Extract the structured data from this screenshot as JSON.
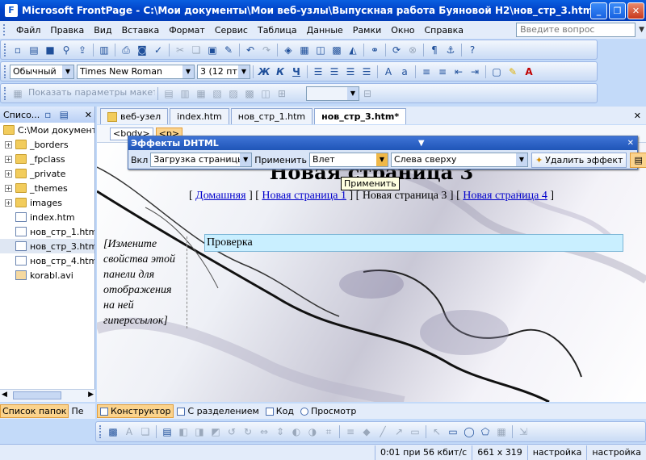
{
  "window": {
    "title": "Microsoft FrontPage - C:\\Мои документы\\Мои веб-узлы\\Выпускная работа Буяновой Н2\\нов_стр_3.htm"
  },
  "menu": {
    "items": [
      "Файл",
      "Правка",
      "Вид",
      "Вставка",
      "Формат",
      "Сервис",
      "Таблица",
      "Данные",
      "Рамки",
      "Окно",
      "Справка"
    ],
    "ask_placeholder": "Введите вопрос"
  },
  "formatting": {
    "style": "Обычный",
    "font": "Times New Roman",
    "size": "3  (12 пт)",
    "bold": "Ж",
    "italic": "К"
  },
  "toolbar3": {
    "layout_label": "Показать параметры макета"
  },
  "left_panel": {
    "title": "Списо...",
    "root": "C:\\Мои документы",
    "items": [
      {
        "name": "_borders",
        "kind": "folder",
        "expand": "+"
      },
      {
        "name": "_fpclass",
        "kind": "folder",
        "expand": "+"
      },
      {
        "name": "_private",
        "kind": "folder",
        "expand": "+"
      },
      {
        "name": "_themes",
        "kind": "folder",
        "expand": "+"
      },
      {
        "name": "images",
        "kind": "folder",
        "expand": "+"
      },
      {
        "name": "index.htm",
        "kind": "file",
        "expand": ""
      },
      {
        "name": "нов_стр_1.htm",
        "kind": "file",
        "expand": ""
      },
      {
        "name": "нов_стр_3.htm",
        "kind": "file",
        "expand": ""
      },
      {
        "name": "нов_стр_4.htm",
        "kind": "file",
        "expand": ""
      },
      {
        "name": "korabl.avi",
        "kind": "media",
        "expand": ""
      }
    ],
    "tab_active": "Список папок",
    "tab_other": "Пе"
  },
  "doc_tabs": [
    "веб-узел",
    "index.htm",
    "нов_стр_1.htm",
    "нов_стр_3.htm*"
  ],
  "tag_selector": {
    "tag1": "<body>",
    "tag2": "<p>"
  },
  "dhtml": {
    "title": "Эффекты DHTML",
    "on_label": "Вкл",
    "on_value": "Загрузка страницы",
    "apply_label": "Применить",
    "apply_value": "Влет",
    "direction_value": "Слева сверху",
    "remove_label": "Удалить эффект",
    "tooltip": "Применить"
  },
  "page": {
    "heading": "Новая страница 3",
    "nav": {
      "b1": "[",
      "link1": "Домашняя",
      "s1": "] [",
      "link2": "Новая страница 1",
      "s2": "] [ Новая страница 3 ] [",
      "link3": "Новая страница 4",
      "b2": "]"
    },
    "side_text": "[Измените свойства этой панели для отображения на ней гиперссылок]",
    "cell_text": "Проверка"
  },
  "view_tabs": [
    "Конструктор",
    "С разделением",
    "Код",
    "Просмотр"
  ],
  "status": {
    "speed": "0:01 при 56 кбит/с",
    "size": "661 x 319",
    "mode1": "настройка",
    "mode2": "настройка"
  },
  "colors": {
    "title_blue": "#0a5fe0",
    "active_tab_orange": "#fbd38c",
    "link_blue": "#0000cc",
    "cell_cyan": "#c9efff"
  }
}
